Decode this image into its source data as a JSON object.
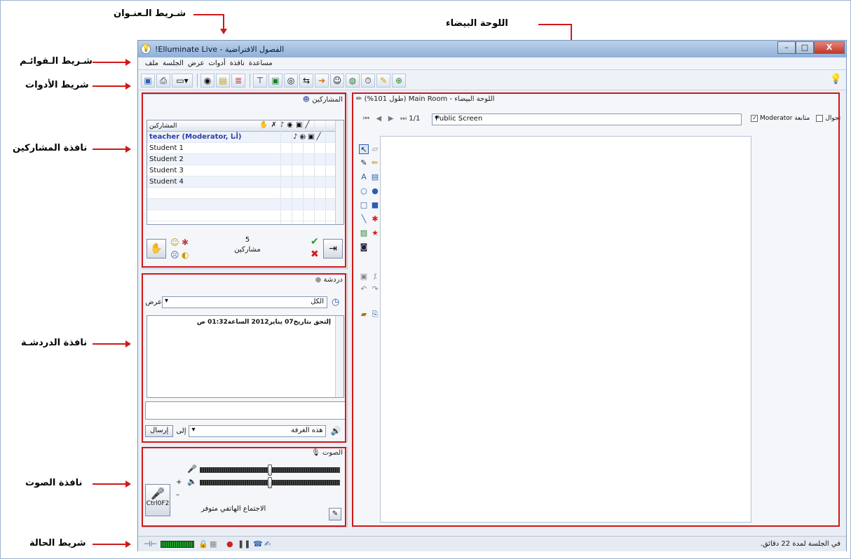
{
  "annotations": {
    "title_bar": "شـريط الـعنـوان",
    "menu_bar": "شـريط الـقوائـم",
    "tools_bar": "شريط الأدوات",
    "participants": "نافذة المشاركين",
    "chat": "نافذة الدردشـة",
    "audio": "نافذة الصوت",
    "status": "شريط الحالة",
    "whiteboard": "اللوحة البيضاء"
  },
  "window": {
    "title": "الفصول الافتراضية - Elluminate Live!",
    "minimize": "–",
    "maximize": "□",
    "close": "X"
  },
  "menu": [
    "ملف",
    "الجلسة",
    "عرض",
    "أدوات",
    "نافذة",
    "مساعدة"
  ],
  "toolbar_icons": [
    "save-icon",
    "print-icon",
    "layout-icon",
    "view-icon",
    "notes-icon",
    "list-icon",
    "projector-icon",
    "app-share-icon",
    "globe-icon",
    "file-transfer-icon",
    "load-icon",
    "profile-icon",
    "web-tour-icon",
    "timer-icon",
    "quiz-icon",
    "add-icon",
    "lightbulb-icon"
  ],
  "participants": {
    "header": "المشاركين",
    "column": "المشاركين",
    "rows": [
      "teacher (Moderator, أنا)",
      "Student 1",
      "Student 2",
      "Student 3",
      "Student 4"
    ],
    "count": "5",
    "count_label": "مشاركين"
  },
  "chat": {
    "header": "دردشة",
    "show_label": "عرض",
    "filter": "الكل",
    "message": "إلتحق بتاريخ07 يناير2012  الساعة01:32 ص",
    "to_label": "إلى",
    "target": "هذه الغرفة",
    "send": "إرسال"
  },
  "audio": {
    "header": "الصوت",
    "talk_key": "Ctrl0F2",
    "phone_status": "الاجتماع الهاتفي متوفر",
    "mic_level": 0.5,
    "speaker_level": 0.5
  },
  "whiteboard": {
    "title": "اللوحة البيضاء - Main Room (طول 101%)",
    "page": "1/1",
    "screen": "Public Screen",
    "follow_label": "متابعة",
    "moderator": "Moderator",
    "explore_label": "تجوال"
  },
  "status": {
    "text": "في الجلسة لمدة 22 دقائق."
  }
}
